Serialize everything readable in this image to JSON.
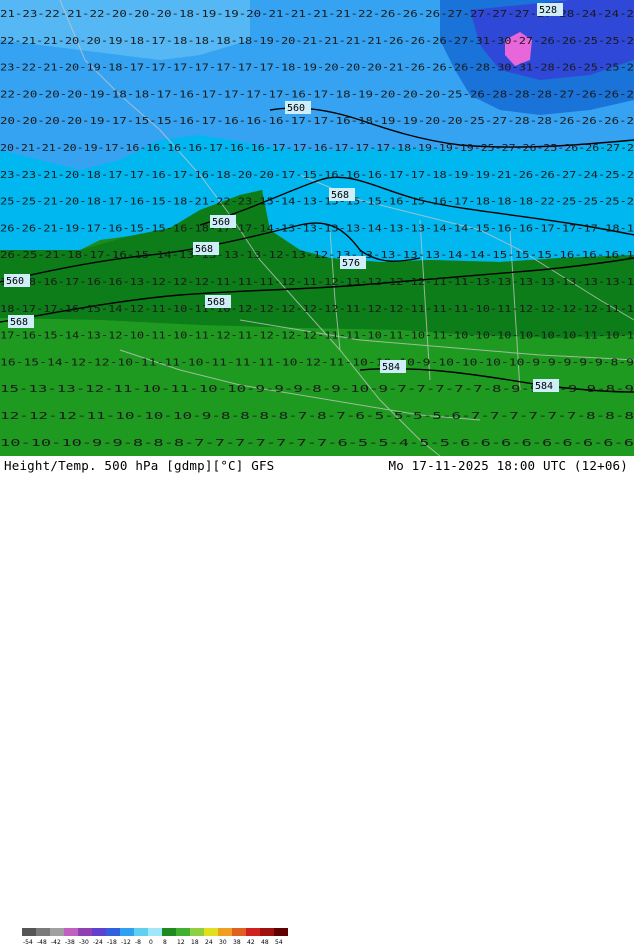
{
  "footer": {
    "title": "Height/Temp. 500 hPa [gdmp][°C] GFS",
    "datetime": "Mo 17-11-2025 18:00 UTC (12+06)"
  },
  "legend": {
    "ticks": [
      "-54",
      "-48",
      "-42",
      "-38",
      "-30",
      "-24",
      "-18",
      "-12",
      "-8",
      "0",
      "8",
      "12",
      "18",
      "24",
      "30",
      "38",
      "42",
      "48",
      "54"
    ],
    "colors": [
      "#555555",
      "#7a7a7a",
      "#a0a0a0",
      "#c060c0",
      "#9040b0",
      "#6040d0",
      "#3060e0",
      "#30a0f0",
      "#60d0f0",
      "#a0e8f8",
      "#208a20",
      "#40b030",
      "#90d040",
      "#e0e020",
      "#f0a020",
      "#e06020",
      "#d02020",
      "#a01010",
      "#600000"
    ]
  },
  "map": {
    "temperature_rows": [
      "21-23-22-21-22-20-20-20-18-19-19-20-21-21-21-21-22-26-26-26-27-27-27-27-27-28-24-24-2",
      "22-21-21-20-20-19-18-17-18-18-18-18-19-20-21-21-21-21-26-26-26-27-31-30-27-26-26-25-25-2",
      "23-22-21-20-19-18-17-17-17-17-17-17-17-18-19-20-20-20-21-26-26-26-28-30-31-28-26-25-25-2",
      "22-20-20-20-19-18-18-17-16-17-17-17-17-16-17-18-19-20-20-20-25-26-28-28-28-27-26-26-2",
      "20-20-20-20-19-17-15-15-16-17-16-16-16-17-17-16-18-19-19-20-20-25-27-28-28-26-26-26-2",
      "20-21-21-20-19-17-16-16-16-16-17-16-16-17-17-16-17-17-17-18-19-19-19-25-27-26-25-26-26-27-2",
      "23-23-21-20-18-17-17-16-17-16-18-20-20-17-15-16-16-16-17-17-18-19-19-21-26-26-27-24-25-2",
      "25-25-21-20-18-17-16-15-18-21-22-23-15-14-13-15-15-15-16-15-16-17-18-18-18-22-25-25-25-2",
      "26-26-21-19-17-16-15-15-16-18-17-17-14-13-13-13-13-14-13-13-14-14-15-16-16-17-17-17-18-1",
      "26-25-21-18-17-16-15-14-13-13-13-13-12-13-12-13-13-13-13-13-14-14-15-15-15-16-16-16-1",
      "18-18-16-17-16-16-13-12-12-12-11-11-11-12-11-12-13-12-12-12-11-11-13-13-13-13-13-13-13-1",
      "18-17-17-16-15-14-12-11-10-11-10-12-12-12-12-12-11-12-12-11-11-11-10-11-12-12-12-12-11-1",
      "17-16-15-14-13-12-10-11-10-11-12-11-12-12-12-11-11-10-11-10-11-10-10-10-10-10-10-11-10-1",
      "16-15-14-12-12-10-11-11-10-11-11-11-10-12-11-10-10-10-9-10-10-10-10-9-9-9-9-9-8-9",
      "15-13-13-12-11-10-11-10-10-9-9-9-8-9-10-9-7-7-7-7-7-8-9-9-9-9-9-8-9",
      "12-12-12-11-10-10-10-9-8-8-8-8-7-8-7-6-5-5-5-5-6-7-7-7-7-7-7-8-8-8",
      "10-10-10-9-9-8-8-8-7-7-7-7-7-7-7-6-5-5-4-5-5-6-6-6-6-6-6-6-6-6"
    ],
    "contour_labels": [
      "560",
      "560",
      "560",
      "568",
      "568",
      "568",
      "568",
      "576",
      "576",
      "584",
      "584",
      "528"
    ]
  }
}
